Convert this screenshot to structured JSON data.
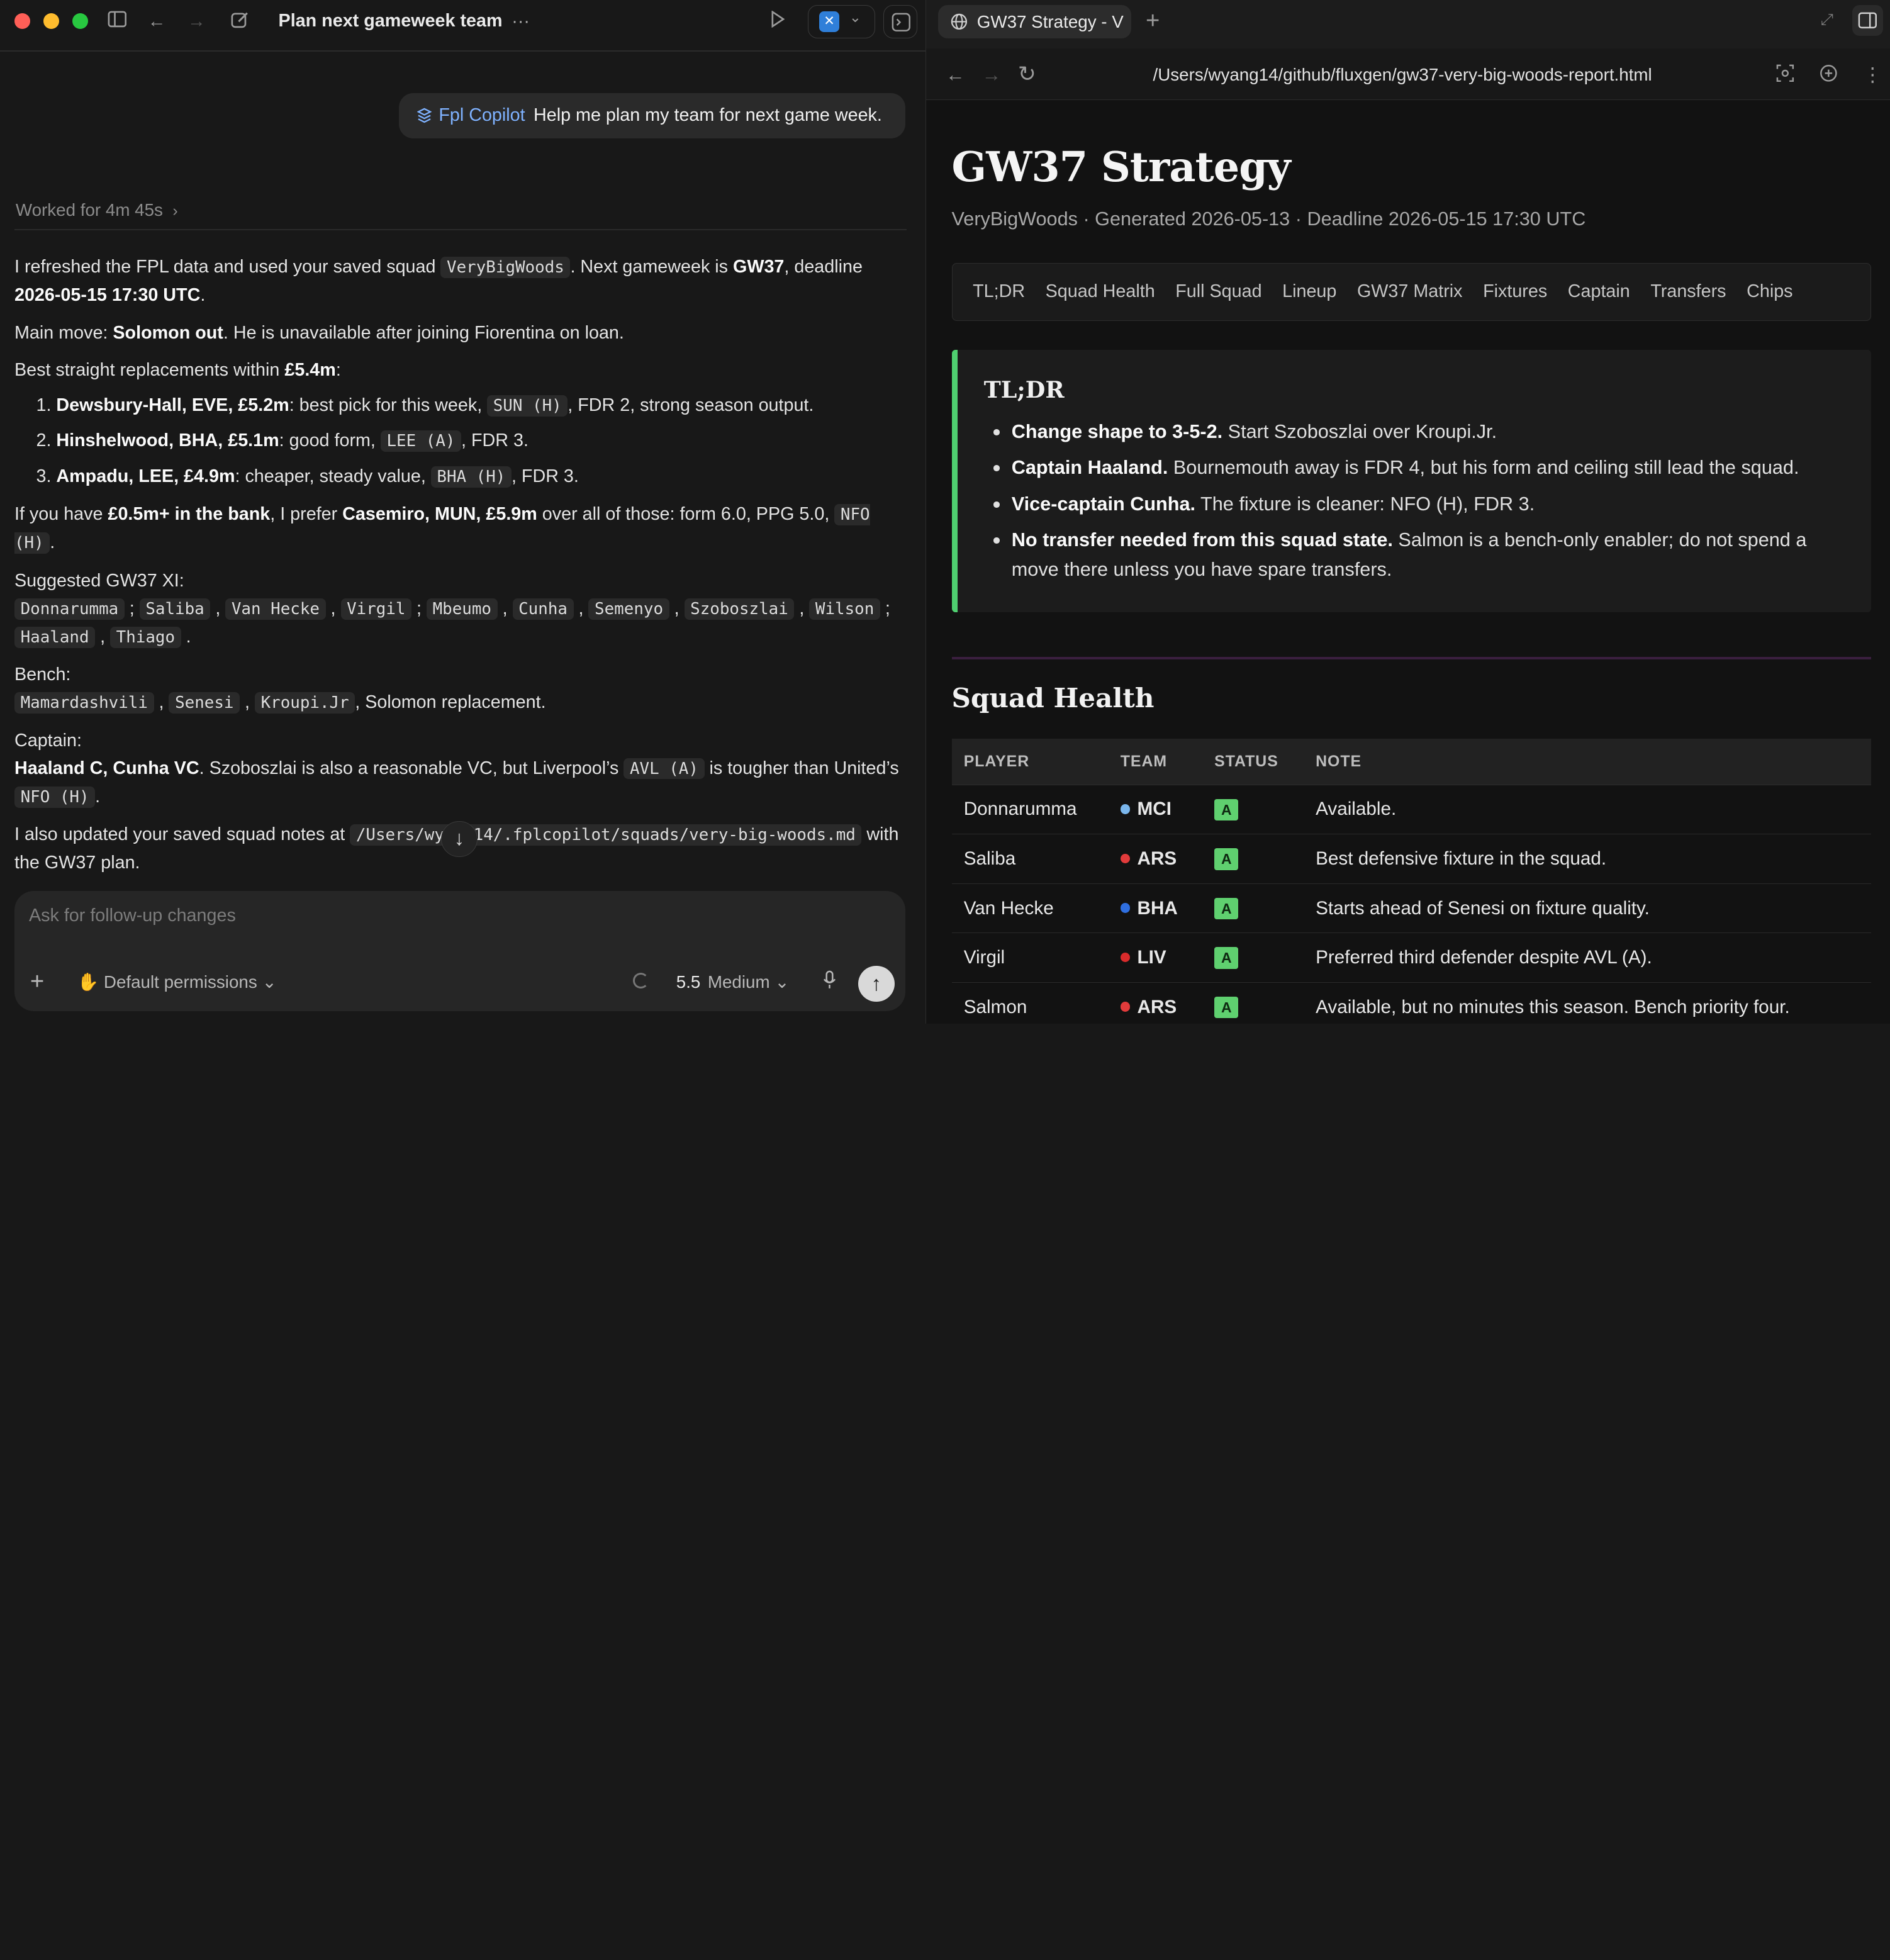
{
  "left": {
    "thread_title": "Plan next gameweek team",
    "user_message": {
      "tag": "Fpl Copilot",
      "text": "Help me plan my team for next game week."
    },
    "worked": "Worked for 4m 45s",
    "p1": {
      "a": "I refreshed the FPL data and used your saved squad ",
      "code": "VeryBigWoods",
      "b": ". Next gameweek is ",
      "gw": "GW37",
      "c": ", deadline ",
      "deadline": "2026-05-15 17:30 UTC",
      "d": "."
    },
    "p2": {
      "a": "Main move: ",
      "b": "Solomon out",
      "c": ". He is unavailable after joining Fiorentina on loan."
    },
    "p3": {
      "a": "Best straight replacements within ",
      "b": "£5.4m",
      "c": ":"
    },
    "repl": [
      {
        "num": "1.",
        "name": "Dewsbury-Hall, EVE, £5.2m",
        "a": ": best pick for this week, ",
        "code": "SUN (H)",
        "b": ", FDR 2, strong season output."
      },
      {
        "num": "2.",
        "name": "Hinshelwood, BHA, £5.1m",
        "a": ": good form, ",
        "code": "LEE (A)",
        "b": ", FDR 3."
      },
      {
        "num": "3.",
        "name": "Ampadu, LEE, £4.9m",
        "a": ": cheaper, steady value, ",
        "code": "BHA (H)",
        "b": ", FDR 3."
      }
    ],
    "p4": {
      "a": "If you have ",
      "b": "£0.5m+ in the bank",
      "c": ", I prefer ",
      "d": "Casemiro, MUN, £5.9m",
      "e": " over all of those: form 6.0, PPG 5.0, ",
      "code": "NFO (H)",
      "f": "."
    },
    "xi_label": "Suggested GW37 XI:",
    "xi": [
      "Donnarumma",
      "Saliba",
      "Van Hecke",
      "Virgil",
      "Mbeumo",
      "Cunha",
      "Semenyo",
      "Szoboszlai",
      "Wilson",
      "Haaland",
      "Thiago"
    ],
    "bench_label": "Bench:",
    "bench": [
      "Mamardashvili",
      "Senesi",
      "Kroupi.Jr"
    ],
    "bench_tail": ", Solomon replacement.",
    "captain_label": "Captain:",
    "captain": {
      "b": "Haaland C, Cunha VC",
      "a": ". Szoboszlai is also a reasonable VC, but Liverpool’s ",
      "code1": "AVL (A)",
      "c": " is tougher than United’s ",
      "code2": "NFO (H)",
      "d": "."
    },
    "p5": {
      "a": "I also updated your saved squad notes at ",
      "code": "/Users/wyang14/.fplcopilot/squads/very-big-woods.md",
      "b": " with the GW37 plan."
    },
    "composer": {
      "placeholder": "Ask for follow-up changes",
      "permissions": "Default permissions",
      "model_version": "5.5",
      "model_effort": "Medium"
    }
  },
  "right": {
    "tab_title": "GW37 Strategy - V",
    "url": "/Users/wyang14/github/fluxgen/gw37-very-big-woods-report.html",
    "title": "GW37 Strategy",
    "subtitle": "VeryBigWoods · Generated 2026-05-13 · Deadline 2026-05-15 17:30 UTC",
    "nav": [
      "TL;DR",
      "Squad Health",
      "Full Squad",
      "Lineup",
      "GW37 Matrix",
      "Fixtures",
      "Captain",
      "Transfers",
      "Chips"
    ],
    "tldr": {
      "heading": "TL;DR",
      "items": [
        {
          "b": "Change shape to 3-5-2.",
          "t": " Start Szoboszlai over Kroupi.Jr."
        },
        {
          "b": "Captain Haaland.",
          "t": " Bournemouth away is FDR 4, but his form and ceiling still lead the squad."
        },
        {
          "b": "Vice-captain Cunha.",
          "t": " The fixture is cleaner: NFO (H), FDR 3."
        },
        {
          "b": "No transfer needed from this squad state.",
          "t": " Salmon is a bench-only enabler; do not spend a move there unless you have spare transfers."
        }
      ]
    },
    "squad_health": {
      "title": "Squad Health",
      "headers": [
        "PLAYER",
        "TEAM",
        "STATUS",
        "NOTE"
      ],
      "rows": [
        {
          "player": "Donnarumma",
          "team": "MCI",
          "color": "#7ab6ec",
          "status": "A",
          "note": "Available."
        },
        {
          "player": "Saliba",
          "team": "ARS",
          "color": "#e23b3b",
          "status": "A",
          "note": "Best defensive fixture in the squad."
        },
        {
          "player": "Van Hecke",
          "team": "BHA",
          "color": "#2f6fe0",
          "status": "A",
          "note": "Starts ahead of Senesi on fixture quality."
        },
        {
          "player": "Virgil",
          "team": "LIV",
          "color": "#d92b2b",
          "status": "A",
          "note": "Preferred third defender despite AVL (A)."
        },
        {
          "player": "Salmon",
          "team": "ARS",
          "color": "#e23b3b",
          "status": "A",
          "note": "Available, but no minutes this season. Bench priority four."
        }
      ]
    }
  }
}
